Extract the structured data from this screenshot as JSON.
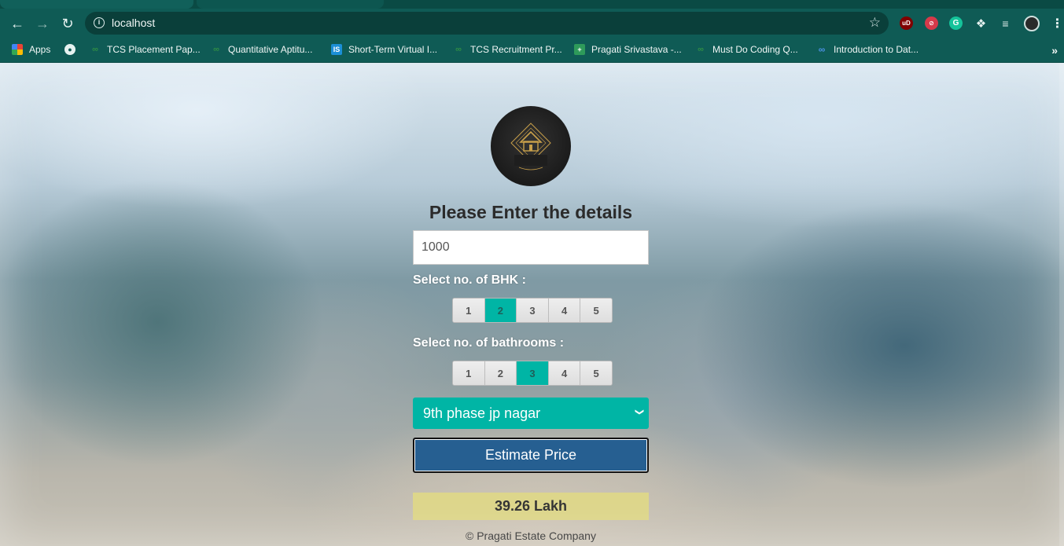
{
  "browser": {
    "url": "localhost",
    "bookmarks": [
      {
        "label": "Apps",
        "icon": "apps-grid-icon"
      },
      {
        "label": "",
        "icon": "globe-icon"
      },
      {
        "label": "TCS Placement Pap...",
        "icon": "geeksforgeeks-icon"
      },
      {
        "label": "Quantitative Aptitu...",
        "icon": "geeksforgeeks-icon"
      },
      {
        "label": "Short-Term Virtual I...",
        "icon": "internshala-icon"
      },
      {
        "label": "TCS Recruitment Pr...",
        "icon": "geeksforgeeks-icon"
      },
      {
        "label": "Pragati Srivastava -...",
        "icon": "plus-icon"
      },
      {
        "label": "Must Do Coding Q...",
        "icon": "geeksforgeeks-icon"
      },
      {
        "label": "Introduction to Dat...",
        "icon": "infinity-icon"
      }
    ],
    "extensions": {
      "ublock": "uD",
      "grammarly": "G"
    }
  },
  "form": {
    "heading": "Please Enter the details",
    "area_value": "1000",
    "bhk_label": "Select no. of BHK :",
    "bhk_options": [
      "1",
      "2",
      "3",
      "4",
      "5"
    ],
    "bhk_selected": "2",
    "bath_label": "Select no. of bathrooms :",
    "bath_options": [
      "1",
      "2",
      "3",
      "4",
      "5"
    ],
    "bath_selected": "3",
    "location_selected": "9th phase jp nagar",
    "estimate_button": "Estimate Price",
    "result": "39.26 Lakh"
  },
  "footer": "© Pragati Estate Company",
  "colors": {
    "accent": "#00b5a5",
    "button": "#265f91",
    "result_bg": "#ddd68b",
    "browser_bar": "#0f5b55"
  }
}
